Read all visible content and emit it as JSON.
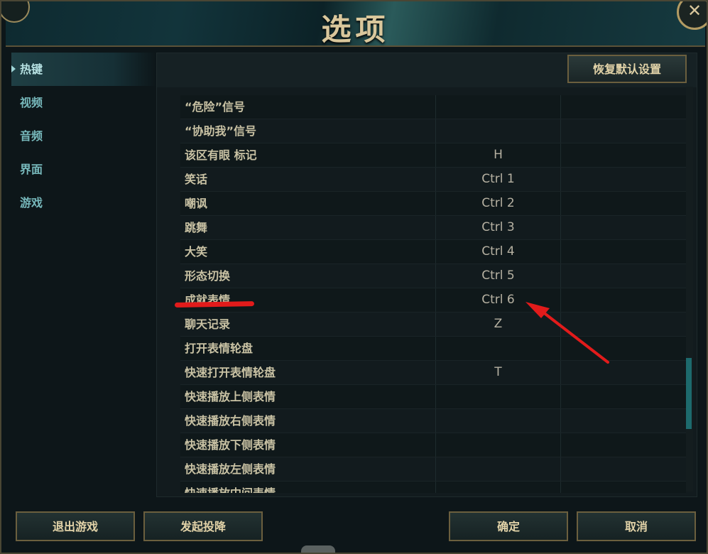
{
  "window": {
    "title": "选项",
    "close_glyph": "✕"
  },
  "sidebar": {
    "items": [
      {
        "label": "热键",
        "active": true
      },
      {
        "label": "视频",
        "active": false
      },
      {
        "label": "音频",
        "active": false
      },
      {
        "label": "界面",
        "active": false
      },
      {
        "label": "游戏",
        "active": false
      }
    ]
  },
  "panel": {
    "restore_defaults_label": "恢复默认设置",
    "hotkeys": [
      {
        "action": "“危险”信号",
        "key": ""
      },
      {
        "action": "“协助我”信号",
        "key": ""
      },
      {
        "action": "该区有眼 标记",
        "key": "H"
      },
      {
        "action": "笑话",
        "key": "Ctrl 1"
      },
      {
        "action": "嘲讽",
        "key": "Ctrl 2"
      },
      {
        "action": "跳舞",
        "key": "Ctrl 3"
      },
      {
        "action": "大笑",
        "key": "Ctrl 4"
      },
      {
        "action": "形态切换",
        "key": "Ctrl 5"
      },
      {
        "action": "成就表情",
        "key": "Ctrl 6"
      },
      {
        "action": "聊天记录",
        "key": "Z"
      },
      {
        "action": "打开表情轮盘",
        "key": ""
      },
      {
        "action": "快速打开表情轮盘",
        "key": "T"
      },
      {
        "action": "快速播放上侧表情",
        "key": ""
      },
      {
        "action": "快速播放右侧表情",
        "key": ""
      },
      {
        "action": "快速播放下侧表情",
        "key": ""
      },
      {
        "action": "快速播放左侧表情",
        "key": ""
      },
      {
        "action": "快速播放中间表情",
        "key": ""
      }
    ]
  },
  "footer": {
    "quit_label": "退出游戏",
    "surrender_label": "发起投降",
    "ok_label": "确定",
    "cancel_label": "取消"
  },
  "annotations": {
    "highlight_color": "#e21b1b"
  },
  "colors": {
    "gold_text": "#d9c79c",
    "teal_text": "#77b8bb",
    "border_gold": "#6b5f3e"
  }
}
